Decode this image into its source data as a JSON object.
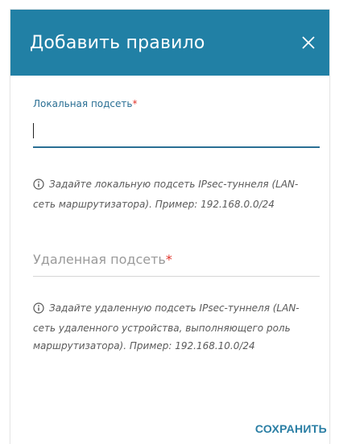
{
  "dialog": {
    "title": "Добавить правило",
    "close_icon": "close-icon"
  },
  "local_subnet": {
    "label": "Локальная подсеть",
    "required_mark": "*",
    "value": "",
    "hint": "Задайте локальную подсеть IPsec-туннеля (LAN-сеть маршрутизатора). Пример: 192.168.0.0/24",
    "hint_icon": "info-icon"
  },
  "remote_subnet": {
    "placeholder": "Удаленная подсеть",
    "required_mark": "*",
    "value": "",
    "hint": "Задайте удаленную подсеть IPsec-туннеля (LAN-сеть удаленного устройства, выполняющего роль маршрутизатора). Пример: 192.168.10.0/24",
    "hint_icon": "info-icon"
  },
  "actions": {
    "save_label": "СОХРАНИТЬ"
  },
  "colors": {
    "header": "#2180a5",
    "accent": "#2a6f94",
    "required": "#e0342b"
  }
}
